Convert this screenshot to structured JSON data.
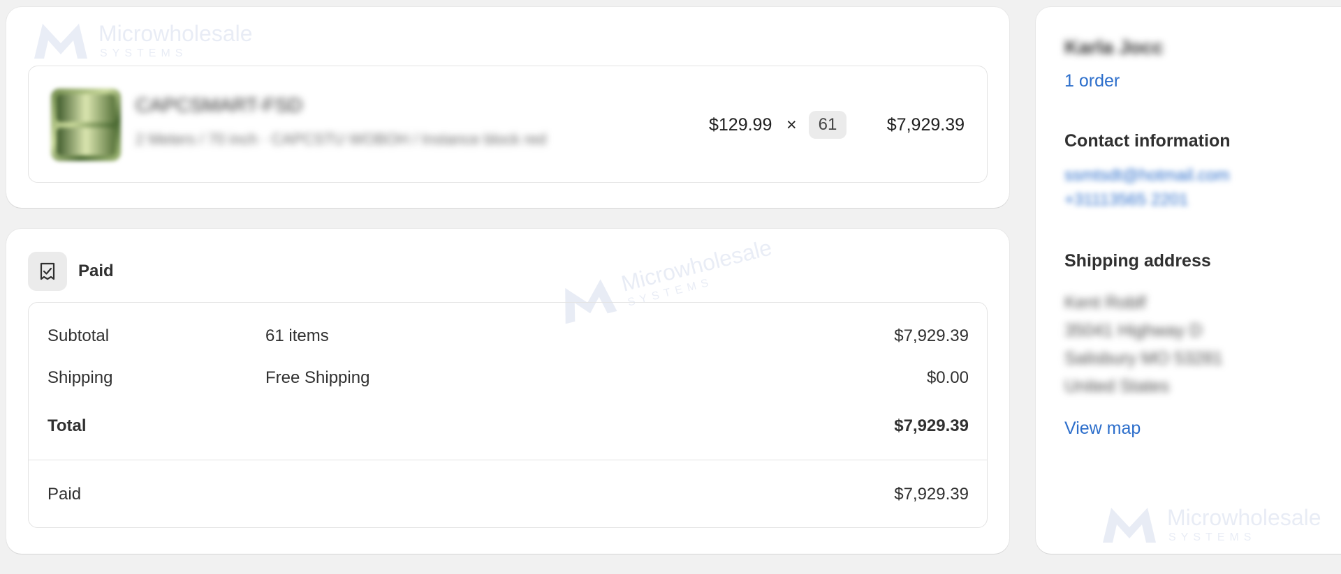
{
  "watermark": {
    "text": "Microwholesale",
    "sub": "SYSTEMS",
    "color": "#2c4fa8"
  },
  "line_item": {
    "product_name": "CAPCSMART-FSD",
    "variant": "2 Meters / 70 inch · CAPCSTU WOBOH / Instance block red",
    "unit_price": "$129.99",
    "times": "×",
    "quantity": "61",
    "line_total": "$7,929.39",
    "thumbnail_icon": "product-thumbnail"
  },
  "payment": {
    "status_icon": "receipt-check-icon",
    "status_title": "Paid",
    "rows": [
      {
        "label": "Subtotal",
        "detail": "61 items",
        "amount": "$7,929.39"
      },
      {
        "label": "Shipping",
        "detail": "Free Shipping",
        "amount": "$0.00"
      },
      {
        "label": "Total",
        "detail": "",
        "amount": "$7,929.39"
      }
    ],
    "paid_row": {
      "label": "Paid",
      "amount": "$7,929.39"
    }
  },
  "customer": {
    "name": "Karla Jocc",
    "orders_link": "1 order",
    "contact_title": "Contact information",
    "email": "ssmtsdt@hotmail.com",
    "phone": "+31113565 2201",
    "shipping_title": "Shipping address",
    "address": [
      "Kent Roblf",
      "35041 Highway D",
      "Salisbury MO 53281",
      "United States"
    ],
    "view_map": "View map"
  },
  "colors": {
    "link": "#2c6ecb",
    "background": "#f1f1f1",
    "card": "#ffffff"
  }
}
